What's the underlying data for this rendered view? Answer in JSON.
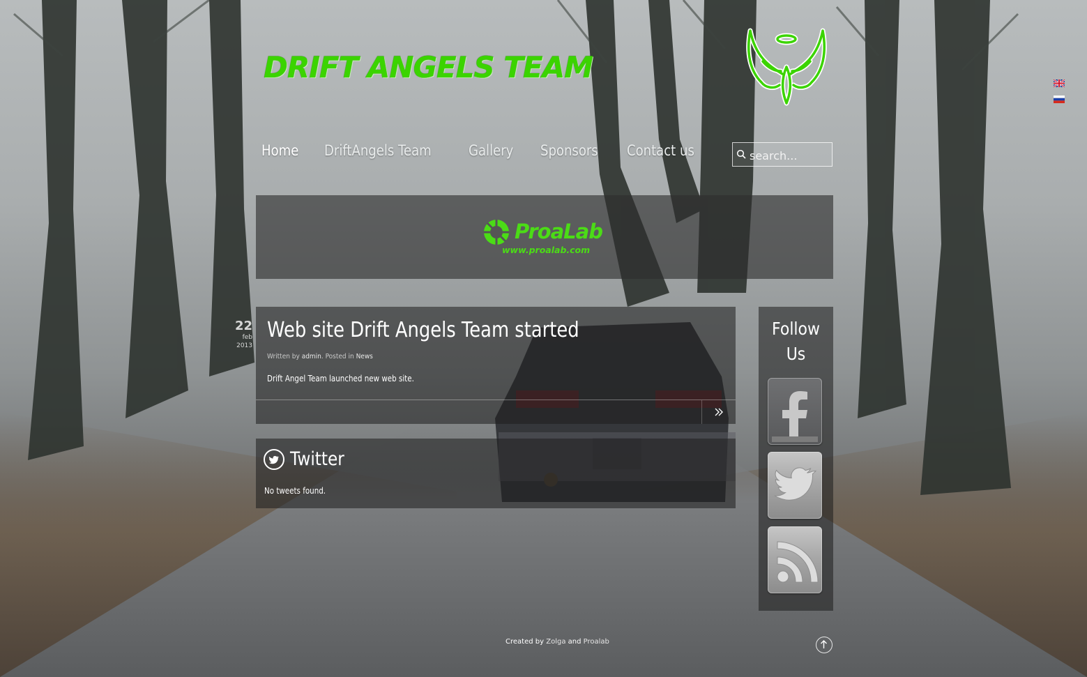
{
  "site": {
    "title": "DRIFT ANGELS TEAM",
    "brand_color": "#3bd400"
  },
  "languages": [
    {
      "code": "en",
      "icon": "uk-flag-icon"
    },
    {
      "code": "ru",
      "icon": "russia-flag-icon"
    }
  ],
  "nav": {
    "items": [
      {
        "label": "Home",
        "active": true
      },
      {
        "label": "DriftAngels Team",
        "active": false
      },
      {
        "label": "Gallery",
        "active": false
      },
      {
        "label": "Sponsors",
        "active": false
      },
      {
        "label": "Contact us",
        "active": false
      }
    ]
  },
  "search": {
    "placeholder": "search..."
  },
  "banner": {
    "sponsor_name": "ProaLab",
    "sponsor_url": "www.proalab.com",
    "accent_color": "#4bdc16"
  },
  "post": {
    "date_day": "22",
    "date_month": "feb",
    "date_year": "2013",
    "title": "Web site Drift Angels Team started",
    "meta_written_by": "Written by",
    "meta_author": "admin",
    "meta_posted_in": ". Posted in",
    "meta_category": "News",
    "body": "Drift Angel Team launched new web site.",
    "more_icon": "double-chevron-right-icon"
  },
  "twitter": {
    "heading": "Twitter",
    "empty_text": "No tweets found.",
    "icon": "twitter-bird-icon"
  },
  "follow": {
    "title": "Follow Us",
    "buttons": [
      {
        "name": "facebook",
        "icon": "facebook-icon"
      },
      {
        "name": "twitter",
        "icon": "twitter-icon"
      },
      {
        "name": "rss",
        "icon": "rss-icon"
      }
    ]
  },
  "footer": {
    "created_by": "Created by",
    "author1": "Zolga",
    "and": "and",
    "author2": "Proalab",
    "totop_icon": "arrow-up-circle-icon"
  }
}
